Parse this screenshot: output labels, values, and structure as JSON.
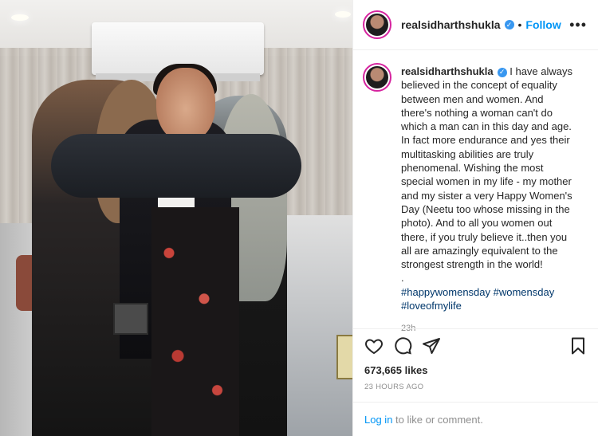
{
  "post": {
    "username": "realsidharthshukla",
    "follow_label": "Follow",
    "separator": "•",
    "more_glyph": "•••",
    "caption_text": "I have always believed in the concept of equality between men and women. And there's nothing a woman can't do which a man can in this day and age. In fact more endurance and yes their multitasking abilities are truly phenomenal. Wishing the most special women in my life - my mother and my sister a very Happy Women's Day (Neetu too whose missing in the photo). And to all you women out there, if you truly believe it..then you all are amazingly equivalent to the strongest strength in the world!",
    "caption_dot": ".",
    "hashtags_line1": "#happywomensday #womensday",
    "hashtags_line2": "#loveofmylife",
    "comment_time": "23h",
    "likes": "673,665 likes",
    "posted_ago": "23 HOURS AGO",
    "login_link": "Log in",
    "login_suffix": " to like or comment."
  },
  "icons": {
    "verified": "verified-badge-icon",
    "like": "heart-icon",
    "comment": "comment-bubble-icon",
    "share": "paper-plane-icon",
    "save": "bookmark-icon"
  },
  "colors": {
    "accent_blue": "#0095f6",
    "verified_blue": "#3897f0",
    "hashtag": "#00376b",
    "muted": "#8e8e8e",
    "text": "#262626"
  }
}
